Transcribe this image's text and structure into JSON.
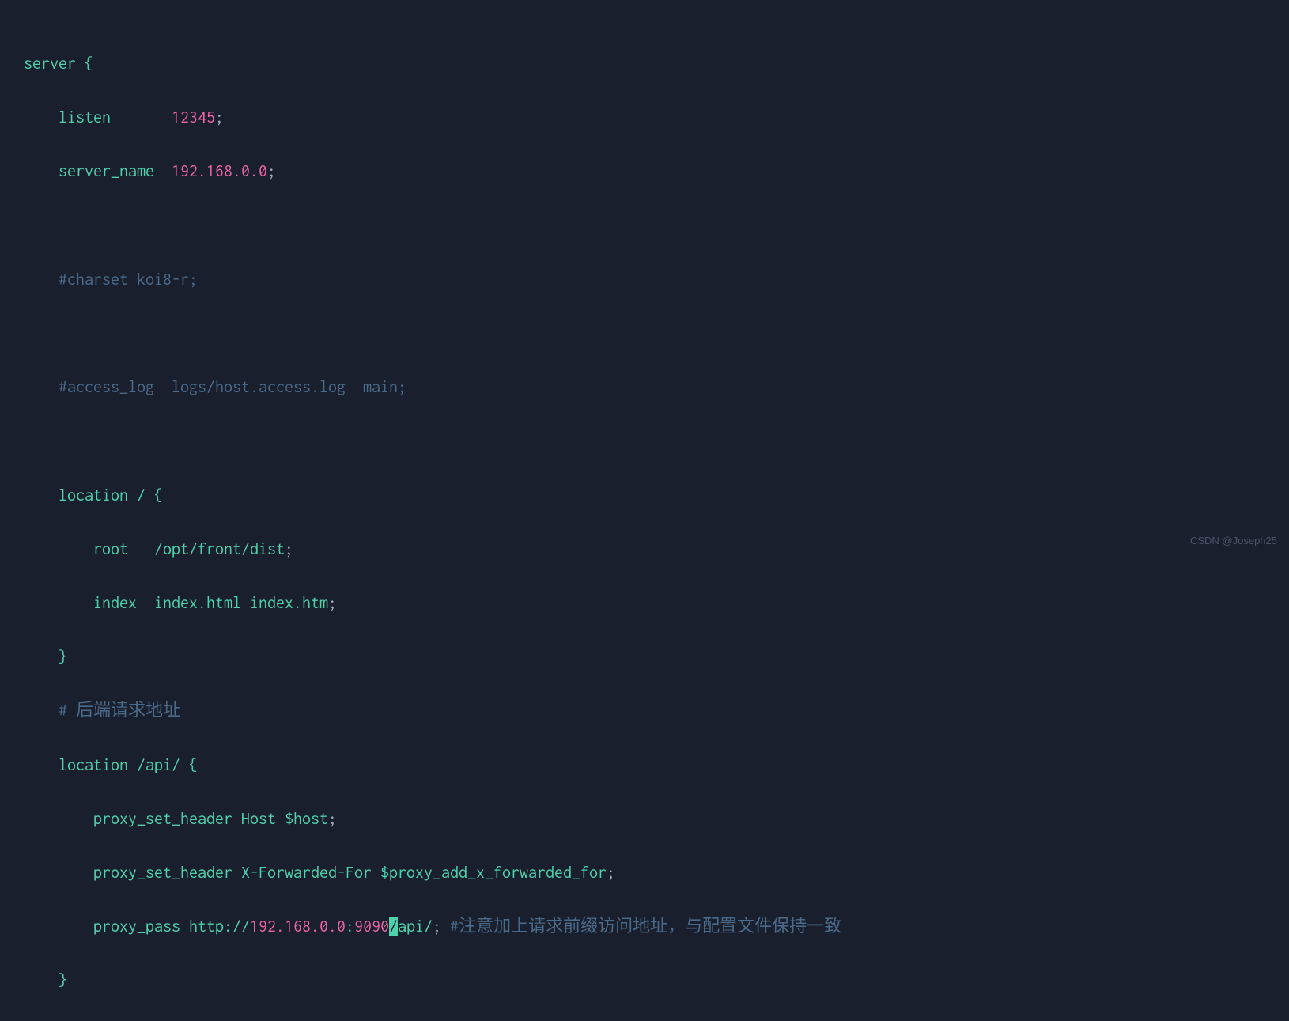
{
  "code": {
    "line1": {
      "keyword": "server",
      "brace": " {"
    },
    "line2": {
      "directive": "listen       ",
      "value": "12345",
      "semi": ";"
    },
    "line3": {
      "directive": "server_name  ",
      "value": "192.168.0.0",
      "semi": ";"
    },
    "line4": "",
    "line5": {
      "comment": "#charset koi8-r;"
    },
    "line6": "",
    "line7": {
      "comment": "#access_log  logs/host.access.log  main;"
    },
    "line8": "",
    "line9": {
      "directive": "location ",
      "path": "/",
      "brace": " {"
    },
    "line10": {
      "directive": "root   ",
      "value": "/opt/front/dist",
      "semi": ";"
    },
    "line11": {
      "directive": "index  ",
      "value": "index.html index.htm",
      "semi": ";"
    },
    "line12": {
      "brace": "}"
    },
    "line13": {
      "comment": "# 后端请求地址"
    },
    "line14": {
      "directive": "location ",
      "path": "/api/",
      "brace": " {"
    },
    "line15": {
      "directive": "proxy_set_header ",
      "header": "Host ",
      "variable": "$host",
      "semi": ";"
    },
    "line16": {
      "directive": "proxy_set_header ",
      "header": "X-Forwarded-For ",
      "variable": "$proxy_add_x_forwarded_for",
      "semi": ";"
    },
    "line17": {
      "directive": "proxy_pass ",
      "protocol": "http://",
      "ip": "192.168.0.0",
      "colon": ":",
      "port": "9090",
      "cursor": "/",
      "path_after": "api/",
      "semi": "; ",
      "comment": "#注意加上请求前缀访问地址，与配置文件保持一致"
    },
    "line18": {
      "brace": "}"
    }
  },
  "watermark": "CSDN @Joseph25"
}
